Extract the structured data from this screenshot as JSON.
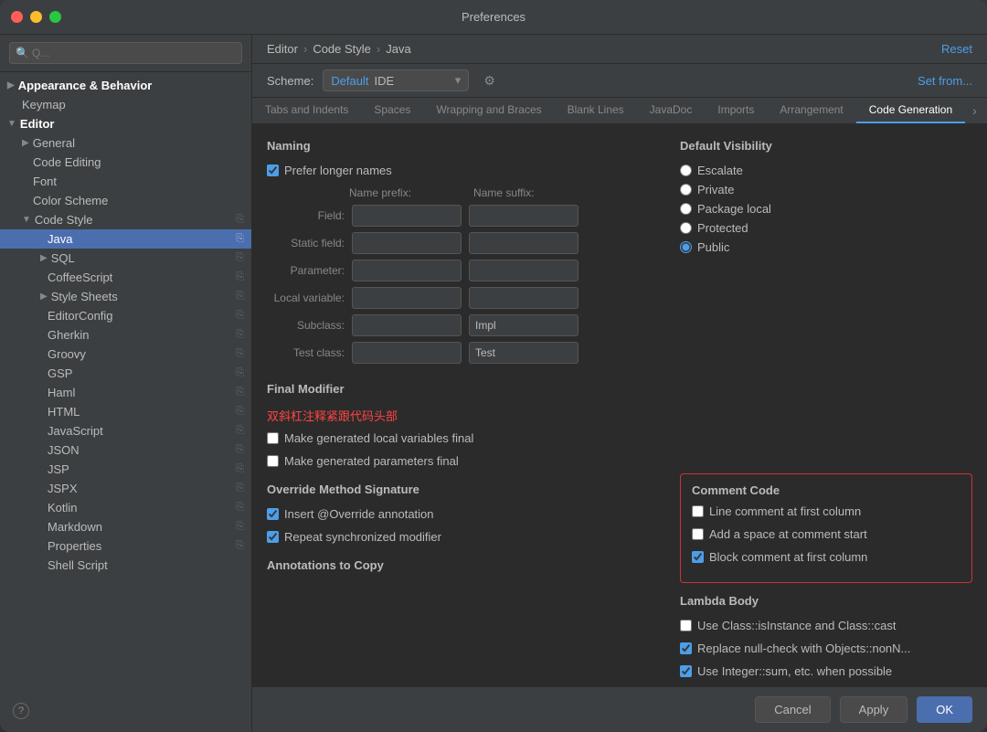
{
  "window": {
    "title": "Preferences"
  },
  "sidebar": {
    "search_placeholder": "Q...",
    "items": [
      {
        "id": "appearance",
        "label": "Appearance & Behavior",
        "level": 0,
        "expandable": true,
        "expanded": false,
        "selected": false
      },
      {
        "id": "keymap",
        "label": "Keymap",
        "level": 1,
        "expandable": false,
        "selected": false
      },
      {
        "id": "editor",
        "label": "Editor",
        "level": 0,
        "expandable": true,
        "expanded": true,
        "selected": false
      },
      {
        "id": "general",
        "label": "General",
        "level": 1,
        "expandable": true,
        "selected": false
      },
      {
        "id": "code-editing",
        "label": "Code Editing",
        "level": 1,
        "expandable": false,
        "selected": false
      },
      {
        "id": "font",
        "label": "Font",
        "level": 1,
        "expandable": false,
        "selected": false
      },
      {
        "id": "color-scheme",
        "label": "Color Scheme",
        "level": 1,
        "expandable": false,
        "selected": false
      },
      {
        "id": "code-style",
        "label": "Code Style",
        "level": 1,
        "expandable": true,
        "expanded": true,
        "selected": false
      },
      {
        "id": "java",
        "label": "Java",
        "level": 2,
        "expandable": false,
        "selected": true
      },
      {
        "id": "sql",
        "label": "SQL",
        "level": 2,
        "expandable": true,
        "selected": false
      },
      {
        "id": "coffeescript",
        "label": "CoffeeScript",
        "level": 2,
        "expandable": false,
        "selected": false
      },
      {
        "id": "style-sheets",
        "label": "Style Sheets",
        "level": 2,
        "expandable": true,
        "selected": false
      },
      {
        "id": "editorconfig",
        "label": "EditorConfig",
        "level": 2,
        "expandable": false,
        "selected": false
      },
      {
        "id": "gherkin",
        "label": "Gherkin",
        "level": 2,
        "expandable": false,
        "selected": false
      },
      {
        "id": "groovy",
        "label": "Groovy",
        "level": 2,
        "expandable": false,
        "selected": false
      },
      {
        "id": "gsp",
        "label": "GSP",
        "level": 2,
        "expandable": false,
        "selected": false
      },
      {
        "id": "haml",
        "label": "Haml",
        "level": 2,
        "expandable": false,
        "selected": false
      },
      {
        "id": "html",
        "label": "HTML",
        "level": 2,
        "expandable": false,
        "selected": false
      },
      {
        "id": "javascript",
        "label": "JavaScript",
        "level": 2,
        "expandable": false,
        "selected": false
      },
      {
        "id": "json",
        "label": "JSON",
        "level": 2,
        "expandable": false,
        "selected": false
      },
      {
        "id": "jsp",
        "label": "JSP",
        "level": 2,
        "expandable": false,
        "selected": false
      },
      {
        "id": "jspx",
        "label": "JSPX",
        "level": 2,
        "expandable": false,
        "selected": false
      },
      {
        "id": "kotlin",
        "label": "Kotlin",
        "level": 2,
        "expandable": false,
        "selected": false
      },
      {
        "id": "markdown",
        "label": "Markdown",
        "level": 2,
        "expandable": false,
        "selected": false
      },
      {
        "id": "properties",
        "label": "Properties",
        "level": 2,
        "expandable": false,
        "selected": false
      },
      {
        "id": "shell-script",
        "label": "Shell Script",
        "level": 2,
        "expandable": false,
        "selected": false
      }
    ]
  },
  "panel": {
    "breadcrumb": {
      "part1": "Editor",
      "sep1": "›",
      "part2": "Code Style",
      "sep2": "›",
      "part3": "Java"
    },
    "reset_label": "Reset",
    "scheme_label": "Scheme:",
    "scheme_value_default": "Default",
    "scheme_value_ide": "IDE",
    "set_from_label": "Set from...",
    "tabs": [
      {
        "id": "tabs-indents",
        "label": "Tabs and Indents",
        "active": false
      },
      {
        "id": "spaces",
        "label": "Spaces",
        "active": false
      },
      {
        "id": "wrapping-braces",
        "label": "Wrapping and Braces",
        "active": false
      },
      {
        "id": "blank-lines",
        "label": "Blank Lines",
        "active": false
      },
      {
        "id": "javadoc",
        "label": "JavaDoc",
        "active": false
      },
      {
        "id": "imports",
        "label": "Imports",
        "active": false
      },
      {
        "id": "arrangement",
        "label": "Arrangement",
        "active": false
      },
      {
        "id": "code-generation",
        "label": "Code Generation",
        "active": true
      }
    ]
  },
  "naming": {
    "section_title": "Naming",
    "prefer_longer_names": {
      "label": "Prefer longer names",
      "checked": true
    },
    "name_prefix_label": "Name prefix:",
    "name_suffix_label": "Name suffix:",
    "fields": [
      {
        "id": "field",
        "label": "Field:",
        "prefix_value": "",
        "suffix_value": ""
      },
      {
        "id": "static-field",
        "label": "Static field:",
        "prefix_value": "",
        "suffix_value": ""
      },
      {
        "id": "parameter",
        "label": "Parameter:",
        "prefix_value": "",
        "suffix_value": ""
      },
      {
        "id": "local-variable",
        "label": "Local variable:",
        "prefix_value": "",
        "suffix_value": ""
      },
      {
        "id": "subclass",
        "label": "Subclass:",
        "prefix_value": "",
        "suffix_value": "Impl"
      },
      {
        "id": "test-class",
        "label": "Test class:",
        "prefix_value": "",
        "suffix_value": "Test"
      }
    ]
  },
  "final_modifier": {
    "section_title": "Final Modifier",
    "annotation_text": "双斜杠注释紧跟代码头部",
    "make_local_final": {
      "label": "Make generated local variables final",
      "checked": false
    },
    "make_params_final": {
      "label": "Make generated parameters final",
      "checked": false
    }
  },
  "comment_code": {
    "section_title": "Comment Code",
    "line_comment_first_col": {
      "label": "Line comment at first column",
      "checked": false
    },
    "add_space_comment": {
      "label": "Add a space at comment start",
      "checked": false
    },
    "block_comment_first_col": {
      "label": "Block comment at first column",
      "checked": true
    }
  },
  "default_visibility": {
    "section_title": "Default Visibility",
    "options": [
      {
        "id": "escalate",
        "label": "Escalate",
        "selected": false
      },
      {
        "id": "private",
        "label": "Private",
        "selected": false
      },
      {
        "id": "package-local",
        "label": "Package local",
        "selected": false
      },
      {
        "id": "protected",
        "label": "Protected",
        "selected": false
      },
      {
        "id": "public",
        "label": "Public",
        "selected": true
      }
    ]
  },
  "override_method": {
    "section_title": "Override Method Signature",
    "insert_override": {
      "label": "Insert @Override annotation",
      "checked": true
    },
    "repeat_synchronized": {
      "label": "Repeat synchronized modifier",
      "checked": true
    }
  },
  "annotations_to_copy": {
    "section_title": "Annotations to Copy"
  },
  "lambda_body": {
    "section_title": "Lambda Body",
    "use_class_instance": {
      "label": "Use Class::isInstance and Class::cast",
      "checked": false
    },
    "replace_null_check": {
      "label": "Replace null-check with Objects::nonN...",
      "checked": true
    },
    "use_integer_sum": {
      "label": "Use Integer::sum, etc. when possible",
      "checked": true
    }
  },
  "bottom_bar": {
    "cancel_label": "Cancel",
    "apply_label": "Apply",
    "ok_label": "OK"
  }
}
